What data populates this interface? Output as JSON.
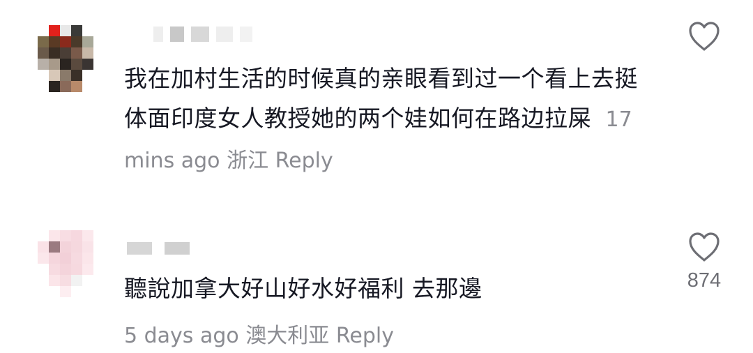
{
  "comments": [
    {
      "username_redacted": true,
      "text": "我在加村生活的时候真的亲眼看到过一个看上去挺体面印度女人教授她的两个娃如何在路边拉屎",
      "time": "17 mins ago",
      "location": "浙江",
      "reply_label": "Reply",
      "like_count": "",
      "liked": false
    },
    {
      "username_redacted": true,
      "text": "聽說加拿大好山好水好福利 去那邊",
      "time": "5 days ago",
      "location": "澳大利亚",
      "reply_label": "Reply",
      "like_count": "874",
      "liked": false
    }
  ],
  "icons": {
    "like": "heart-outline-icon"
  }
}
